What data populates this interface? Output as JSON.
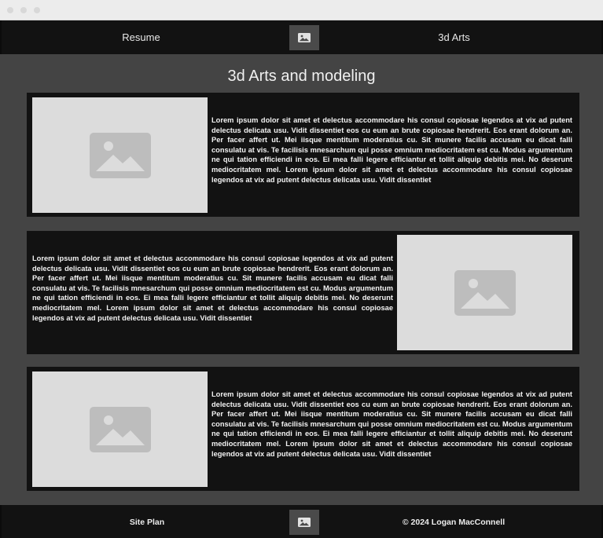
{
  "colors": {
    "page_background": "#444444",
    "bar_background": "#121212",
    "logo_box": "#4a4a4a",
    "placeholder": "#dcdcdc",
    "placeholder_icon": "#bdbdbd",
    "text": "#f2f2f2"
  },
  "header": {
    "nav_left_label": "Resume",
    "nav_right_label": "3d Arts",
    "logo_icon": "image-placeholder-icon"
  },
  "main": {
    "title": "3d Arts and modeling",
    "cards": [
      {
        "image_icon": "image-placeholder-icon",
        "image_side": "left",
        "text": "Lorem ipsum dolor sit amet et delectus accommodare his consul copiosae legendos at vix ad putent delectus delicata usu. Vidit dissentiet eos cu eum an brute copiosae hendrerit. Eos erant dolorum an. Per facer affert ut. Mei iisque mentitum moderatius cu. Sit munere facilis accusam eu dicat falli consulatu at vis. Te facilisis mnesarchum qui posse omnium mediocritatem est cu. Modus argumentum ne qui tation efficiendi in eos. Ei mea falli legere efficiantur et tollit aliquip debitis mei. No deserunt mediocritatem mel. Lorem ipsum dolor sit amet et delectus accommodare his consul copiosae legendos at vix ad putent delectus delicata usu. Vidit dissentiet"
      },
      {
        "image_icon": "image-placeholder-icon",
        "image_side": "right",
        "text": "Lorem ipsum dolor sit amet et delectus accommodare his consul copiosae legendos at vix ad putent delectus delicata usu. Vidit dissentiet eos cu eum an brute copiosae hendrerit. Eos erant dolorum an. Per facer affert ut. Mei iisque mentitum moderatius cu. Sit munere facilis accusam eu dicat falli consulatu at vis. Te facilisis mnesarchum qui posse omnium mediocritatem est cu. Modus argumentum ne qui tation efficiendi in eos. Ei mea falli legere efficiantur et tollit aliquip debitis mei. No deserunt mediocritatem mel. Lorem ipsum dolor sit amet et delectus accommodare his consul copiosae legendos at vix ad putent delectus delicata usu. Vidit dissentiet"
      },
      {
        "image_icon": "image-placeholder-icon",
        "image_side": "left",
        "text": "Lorem ipsum dolor sit amet et delectus accommodare his consul copiosae legendos at vix ad putent delectus delicata usu. Vidit dissentiet eos cu eum an brute copiosae hendrerit. Eos erant dolorum an. Per facer affert ut. Mei iisque mentitum moderatius cu. Sit munere facilis accusam eu dicat falli consulatu at vis. Te facilisis mnesarchum qui posse omnium mediocritatem est cu. Modus argumentum ne qui tation efficiendi in eos. Ei mea falli legere efficiantur et tollit aliquip debitis mei. No deserunt mediocritatem mel. Lorem ipsum dolor sit amet et delectus accommodare his consul copiosae legendos at vix ad putent delectus delicata usu. Vidit dissentiet"
      }
    ]
  },
  "footer": {
    "site_plan_label": "Site Plan",
    "copyright": "© 2024 Logan MacConnell",
    "logo_icon": "image-placeholder-icon"
  }
}
